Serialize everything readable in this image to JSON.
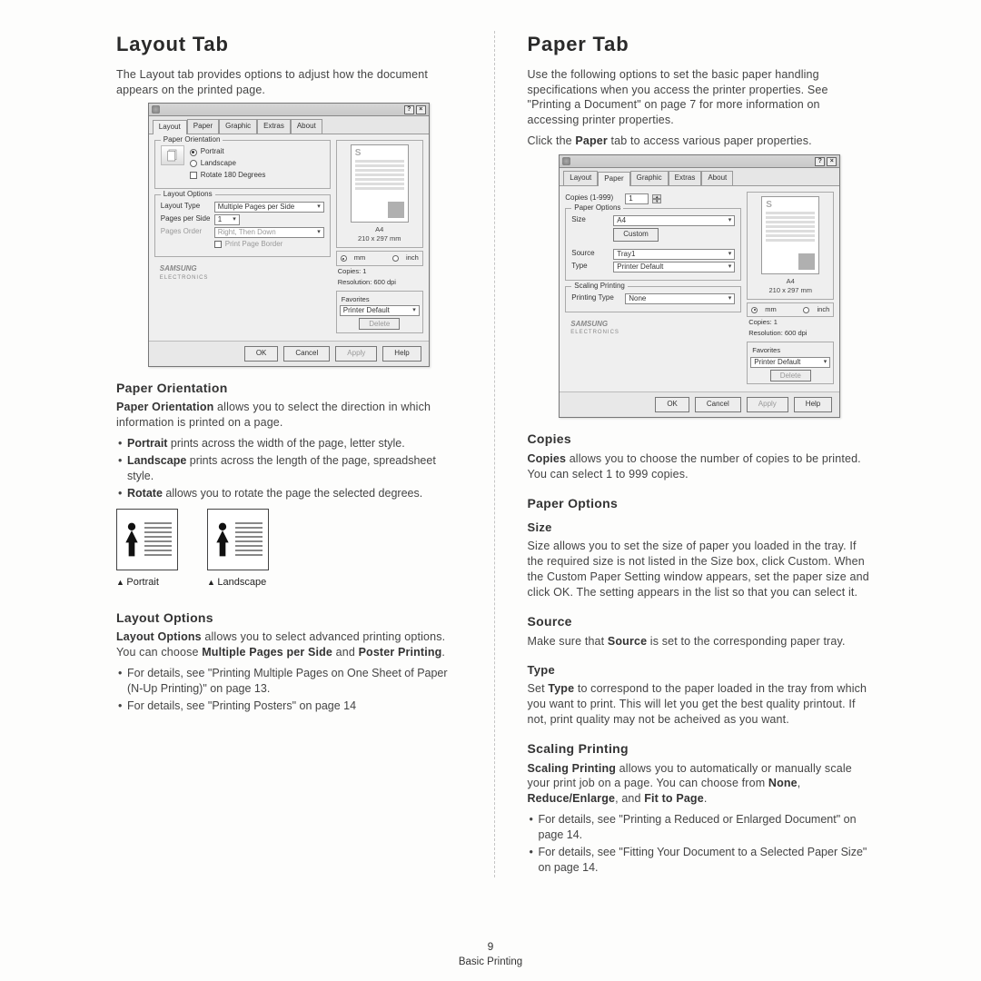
{
  "left": {
    "title": "Layout Tab",
    "intro": "The Layout tab provides options to adjust how the document appears on the printed page.",
    "orientation": {
      "heading": "Paper Orientation",
      "lead_bold": "Paper Orientation",
      "lead_rest": " allows you to select the direction in which information is printed on a page.",
      "b1_bold": "Portrait",
      "b1_rest": " prints across the width of the page, letter style.",
      "b2_bold": "Landscape",
      "b2_rest": " prints across the length of the page, spreadsheet style.",
      "b3_bold": "Rotate",
      "b3_rest": " allows you to rotate the page the selected degrees.",
      "thumb_portrait": "Portrait",
      "thumb_landscape": "Landscape"
    },
    "layout_options": {
      "heading": "Layout Options",
      "l1a": "Layout Options",
      "l1b": " allows you to select advanced printing options. You can choose ",
      "l1c": "Multiple Pages per Side",
      "l1d": " and ",
      "l1e": "Poster Printing",
      "l1f": ".",
      "b1": "For details, see \"Printing Multiple Pages on One Sheet of Paper (N-Up Printing)\" on page 13.",
      "b2": "For details, see \"Printing Posters\" on page 14"
    },
    "dialog": {
      "tabs": [
        "Layout",
        "Paper",
        "Graphic",
        "Extras",
        "About"
      ],
      "active_tab": "Layout",
      "group1_title": "Paper Orientation",
      "portrait": "Portrait",
      "landscape": "Landscape",
      "rotate": "Rotate 180 Degrees",
      "group2_title": "Layout Options",
      "layout_type_lbl": "Layout Type",
      "layout_type_val": "Multiple Pages per Side",
      "pps_lbl": "Pages per Side",
      "pps_val": "1",
      "order_lbl": "Pages Order",
      "order_val": "Right, Then Down",
      "border": "Print Page Border",
      "preview_caption_a": "A4",
      "preview_caption_b": "210 x 297 mm",
      "unit_mm": "mm",
      "unit_inch": "inch",
      "copies_line": "Copies: 1",
      "res_line": "Resolution: 600 dpi",
      "fav_title": "Favorites",
      "fav_val": "Printer Default",
      "delete": "Delete",
      "ok": "OK",
      "cancel": "Cancel",
      "apply": "Apply",
      "help": "Help",
      "logo_a": "SAMSUNG",
      "logo_b": "ELECTRONICS"
    }
  },
  "right": {
    "title": "Paper Tab",
    "p1": "Use the following options to set the basic paper handling specifications when you access the printer properties. See \"Printing a Document\" on page 7 for more information on accessing printer properties.",
    "p2a": "Click the ",
    "p2b": "Paper",
    "p2c": " tab to access various paper properties.",
    "dialog": {
      "tabs": [
        "Layout",
        "Paper",
        "Graphic",
        "Extras",
        "About"
      ],
      "active_tab": "Paper",
      "copies_lbl": "Copies (1-999)",
      "copies_val": "1",
      "group1_title": "Paper Options",
      "size_lbl": "Size",
      "size_val": "A4",
      "custom_btn": "Custom",
      "source_lbl": "Source",
      "source_val": "Tray1",
      "type_lbl": "Type",
      "type_val": "Printer Default",
      "group2_title": "Scaling Printing",
      "ptype_lbl": "Printing Type",
      "ptype_val": "None",
      "preview_caption_a": "A4",
      "preview_caption_b": "210 x 297 mm",
      "unit_mm": "mm",
      "unit_inch": "inch",
      "copies_line": "Copies: 1",
      "res_line": "Resolution: 600 dpi",
      "fav_title": "Favorites",
      "fav_val": "Printer Default",
      "delete": "Delete",
      "ok": "OK",
      "cancel": "Cancel",
      "apply": "Apply",
      "help": "Help",
      "logo_a": "SAMSUNG",
      "logo_b": "ELECTRONICS"
    },
    "copies_h": "Copies",
    "copies_p_a": "Copies",
    "copies_p_b": " allows you to choose the number of copies to be printed. You can select 1 to 999 copies.",
    "po_h": "Paper Options",
    "size_h": "Size",
    "size_p": "Size allows you to set the size of paper you loaded in the tray. If the required size is not listed in the Size box, click Custom. When the Custom Paper Setting window appears, set the paper size and click OK. The setting appears in the list so that you can select it.",
    "source_h": "Source",
    "source_p_a": "Make sure that ",
    "source_p_b": "Source",
    "source_p_c": " is set to the corresponding paper tray.",
    "type_h": "Type",
    "type_p_a": "Set ",
    "type_p_b": "Type",
    "type_p_c": " to correspond to the paper loaded in the tray from which you want to print. This will let you get the best quality printout. If not, print quality may not be acheived as you want.",
    "scale_h": "Scaling Printing",
    "scale_p_a": "Scaling Printing",
    "scale_p_b": " allows you to automatically or manually scale your print job on a page. You can choose from ",
    "scale_p_c": "None",
    "scale_p_d": ", ",
    "scale_p_e": "Reduce/Enlarge",
    "scale_p_f": ", and ",
    "scale_p_g": "Fit to Page",
    "scale_p_h": ".",
    "scale_b1": "For details, see \"Printing a Reduced or Enlarged Document\" on page 14.",
    "scale_b2": "For details, see \"Fitting Your Document to a Selected Paper Size\" on page 14."
  },
  "footer": {
    "page_number": "9",
    "section": "Basic Printing"
  }
}
